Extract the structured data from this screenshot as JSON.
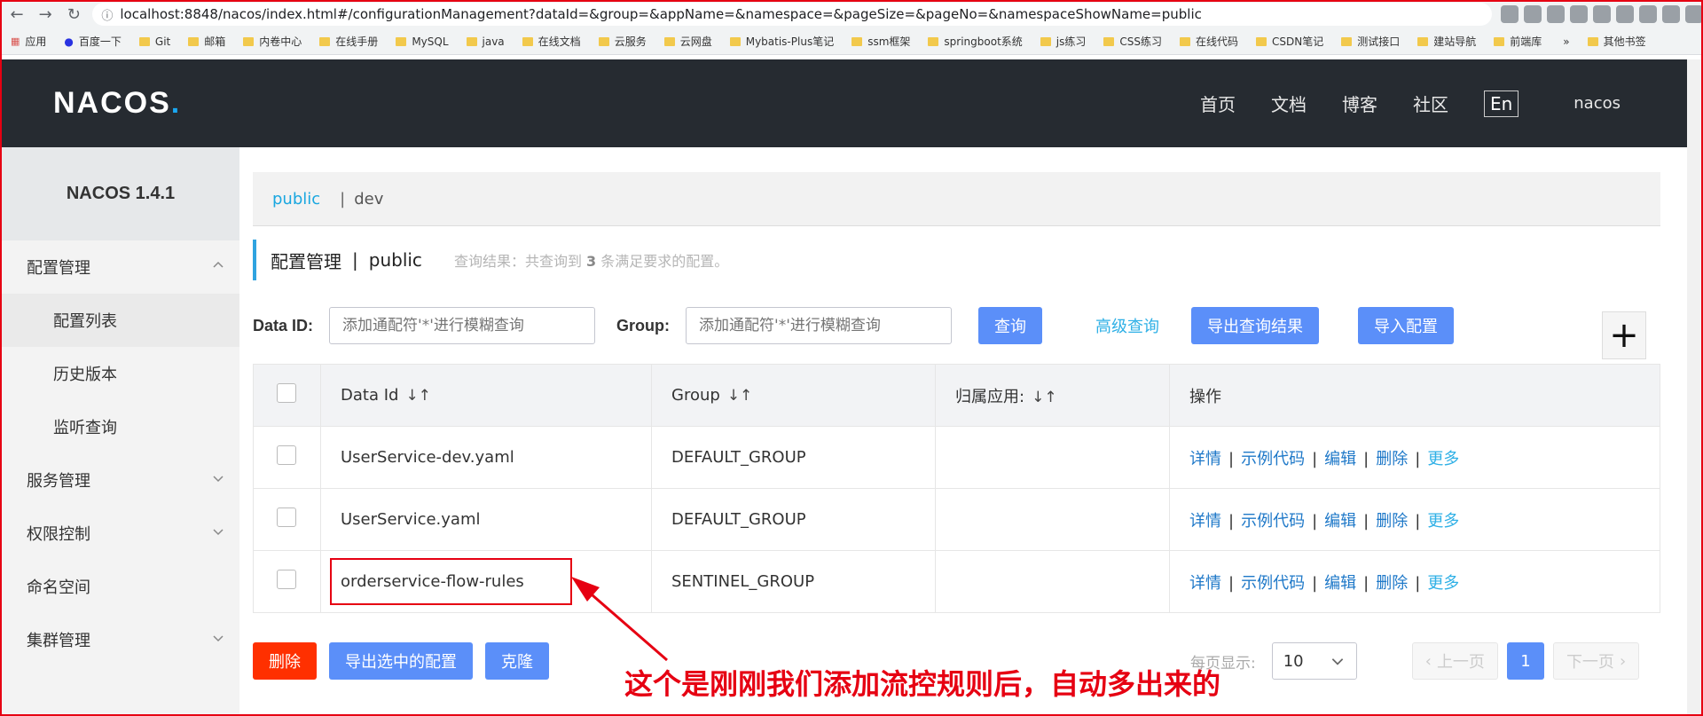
{
  "browser": {
    "url": "localhost:8848/nacos/index.html#/configurationManagement?dataId=&group=&appName=&namespace=&pageSize=&pageNo=&namespaceShowName=public",
    "bookmarks": [
      "应用",
      "百度一下",
      "Git",
      "邮箱",
      "内卷中心",
      "在线手册",
      "MySQL",
      "java",
      "在线文档",
      "云服务",
      "云网盘",
      "Mybatis-Plus笔记",
      "ssm框架",
      "springboot系统",
      "js练习",
      "CSS练习",
      "在线代码",
      "CSDN笔记",
      "测试接口",
      "建站导航",
      "前端库"
    ],
    "other_bookmarks": "其他书签"
  },
  "header": {
    "logo": "NACOS",
    "logo_dot": ".",
    "nav": [
      "首页",
      "文档",
      "博客",
      "社区"
    ],
    "lang": "En",
    "user": "nacos"
  },
  "sidebar": {
    "title": "NACOS 1.4.1",
    "items": [
      {
        "label": "配置管理"
      },
      {
        "label": "配置列表"
      },
      {
        "label": "历史版本"
      },
      {
        "label": "监听查询"
      },
      {
        "label": "服务管理"
      },
      {
        "label": "权限控制"
      },
      {
        "label": "命名空间"
      },
      {
        "label": "集群管理"
      }
    ]
  },
  "namespaces": {
    "active": "public",
    "sep": "|",
    "other": "dev"
  },
  "page": {
    "title": "配置管理",
    "pipe": "|",
    "namespace": "public",
    "result_prefix": "查询结果：共查询到",
    "result_count": "3",
    "result_suffix": "条满足要求的配置。"
  },
  "filter": {
    "dataid_label": "Data ID:",
    "dataid_placeholder": "添加通配符'*'进行模糊查询",
    "group_label": "Group:",
    "group_placeholder": "添加通配符'*'进行模糊查询",
    "query": "查询",
    "advanced": "高级查询",
    "export": "导出查询结果",
    "import": "导入配置",
    "add": "+"
  },
  "table": {
    "headers": [
      "Data Id",
      "Group",
      "归属应用:",
      "操作"
    ],
    "sort_glyph": "↓↑",
    "rows": [
      {
        "data_id": "UserService-dev.yaml",
        "group": "DEFAULT_GROUP",
        "app": ""
      },
      {
        "data_id": "UserService.yaml",
        "group": "DEFAULT_GROUP",
        "app": ""
      },
      {
        "data_id": "orderservice-flow-rules",
        "group": "SENTINEL_GROUP",
        "app": ""
      }
    ],
    "ops": [
      "详情",
      "示例代码",
      "编辑",
      "删除",
      "更多"
    ],
    "op_sep": "|"
  },
  "footer": {
    "delete": "删除",
    "export_selected": "导出选中的配置",
    "clone": "克隆",
    "per_page_label": "每页显示:",
    "page_size": "10",
    "prev": "上一页",
    "current_page": "1",
    "next": "下一页"
  },
  "annotation": {
    "text": "这个是刚刚我们添加流控规则后，自动多出来的",
    "color": "#e60012"
  }
}
